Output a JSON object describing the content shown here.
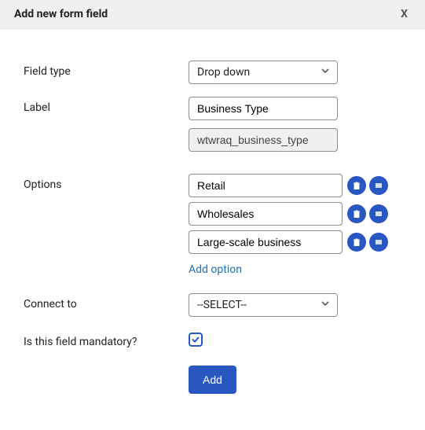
{
  "modal": {
    "title": "Add new form field",
    "close": "X"
  },
  "labels": {
    "field_type": "Field type",
    "label": "Label",
    "options": "Options",
    "connect_to": "Connect to",
    "mandatory": "Is this field mandatory?"
  },
  "field_type": {
    "selected": "Drop down"
  },
  "label_field": {
    "value": "Business Type",
    "slug": "wtwraq_business_type"
  },
  "options": [
    {
      "value": "Retail"
    },
    {
      "value": "Wholesales"
    },
    {
      "value": "Large-scale business"
    }
  ],
  "add_option_label": "Add option",
  "connect_to": {
    "selected": "--SELECT--"
  },
  "mandatory_checked": true,
  "submit_label": "Add"
}
